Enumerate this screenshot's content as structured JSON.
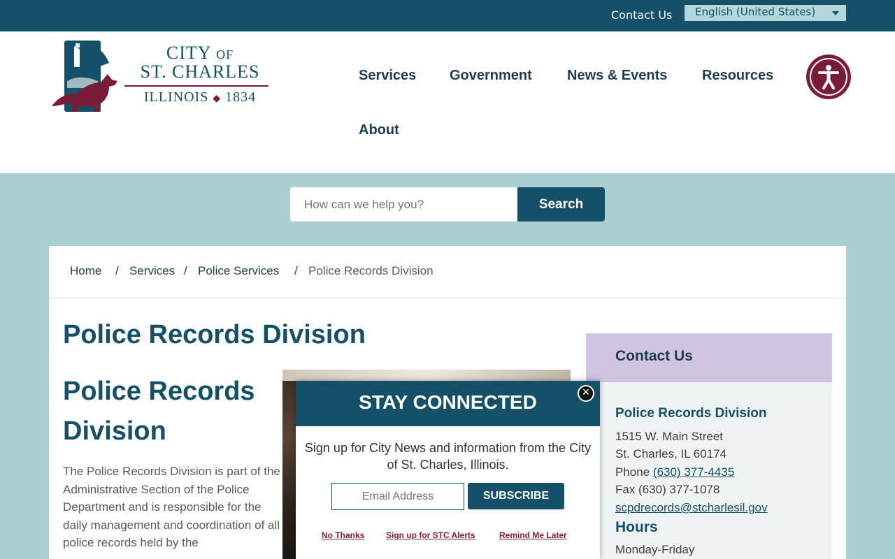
{
  "topbar": {
    "contact_label": "Contact Us",
    "language": "English (United States)"
  },
  "logo": {
    "city": "CITY",
    "of": "OF",
    "name": "ST. CHARLES",
    "state": "ILLINOIS",
    "year": "1834"
  },
  "nav": {
    "items": [
      "Services",
      "Government",
      "News & Events",
      "Resources",
      "About"
    ]
  },
  "search": {
    "placeholder": "How can we help you?",
    "button_label": "Search"
  },
  "breadcrumb": {
    "items": [
      "Home",
      "Services",
      "Police Services",
      "Police Records Division"
    ],
    "separator": "/"
  },
  "main": {
    "page_title": "Police Records Division",
    "heading": "Police Records Division",
    "body": "The Police Records Division is part of the Administrative Section of the Police Department and is responsible for the daily management and coordination of all police records held by the"
  },
  "sidebar": {
    "title": "Contact Us",
    "dept": "Police Records Division",
    "address1": "1515 W. Main Street",
    "address2": "St. Charles, IL 60174",
    "phone_label": "Phone",
    "phone": "(630) 377-4435",
    "fax": "Fax (630) 377-1078",
    "email": "scpdrecords@stcharlesil.gov",
    "hours_title": "Hours",
    "hours_line": "Monday-Friday"
  },
  "modal": {
    "title": "STAY CONNECTED",
    "close_glyph": "✕",
    "message": "Sign up for City News and information from the City of St. Charles, Illinois.",
    "email_placeholder": "Email Address",
    "subscribe_label": "SUBSCRIBE",
    "links": [
      "No Thanks",
      "Sign up for STC Alerts",
      "Remind Me Later"
    ]
  },
  "colors": {
    "brand_teal": "#145067",
    "accent_maroon": "#7b1c37",
    "band_bg": "#a9cfd3",
    "contact_header_bg": "#cfc5e0"
  },
  "icons": [
    "fox-tower-emblem-icon",
    "caret-down-icon",
    "accessibility-icon",
    "close-icon"
  ]
}
